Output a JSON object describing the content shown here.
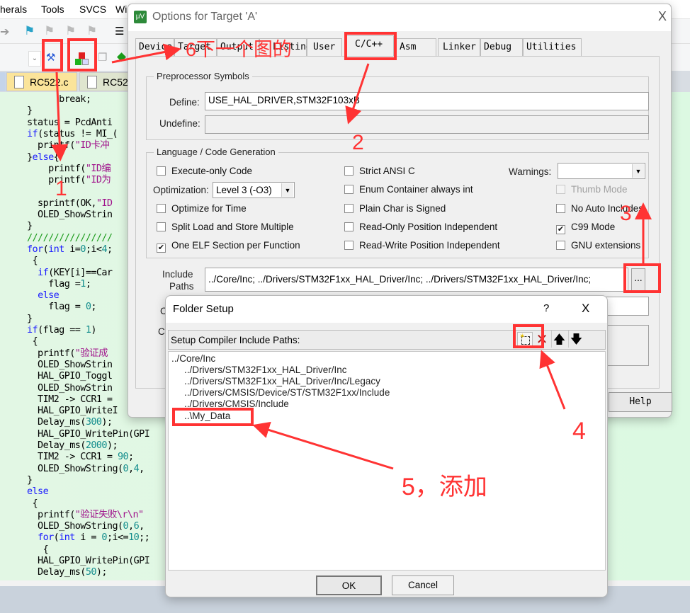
{
  "menubar": {
    "items": [
      "herals",
      "Tools",
      "SVCS",
      "Wi"
    ]
  },
  "file_tabs": [
    {
      "label": "RC522.c",
      "active": true
    },
    {
      "label": "RC52",
      "active": false
    }
  ],
  "editor": {
    "lines": [
      [
        [
          "      ",
          ""
        ],
        [
          "break",
          ""
        ],
        [
          ";",
          ""
        ]
      ],
      [
        [
          "}",
          ""
        ]
      ],
      [
        [
          "status = PcdAnti",
          ""
        ]
      ],
      [
        [
          "if",
          "kw"
        ],
        [
          "(status != MI_(",
          ""
        ]
      ],
      [
        [
          "  printf(",
          ""
        ],
        [
          "\"ID卡冲",
          "st"
        ]
      ],
      [
        [
          "}",
          "",
          ""
        ],
        [
          "else",
          "kw"
        ],
        [
          "{",
          ""
        ]
      ],
      [
        [
          "    printf(",
          ""
        ],
        [
          "\"ID编",
          "st"
        ]
      ],
      [
        [
          "    printf(",
          ""
        ],
        [
          "\"ID为",
          "st"
        ]
      ],
      [
        [
          "",
          ""
        ]
      ],
      [
        [
          "  sprintf(OK,",
          ""
        ],
        [
          "\"ID",
          "st"
        ]
      ],
      [
        [
          "  OLED_ShowStrin",
          ""
        ]
      ],
      [
        [
          "}",
          ""
        ]
      ],
      [
        [
          "////////////////",
          "cm"
        ]
      ],
      [
        [
          "for",
          "kw"
        ],
        [
          "(",
          ""
        ],
        [
          "int",
          "kw"
        ],
        [
          " i=",
          ""
        ],
        [
          "0",
          "nm"
        ],
        [
          ";i<",
          ""
        ],
        [
          "4",
          "nm"
        ],
        [
          ";",
          ""
        ]
      ],
      [
        [
          " {",
          ""
        ]
      ],
      [
        [
          "  ",
          ""
        ],
        [
          "if",
          "kw"
        ],
        [
          "(KEY[i]==Car",
          ""
        ]
      ],
      [
        [
          "    flag =",
          ""
        ],
        [
          "1",
          "nm"
        ],
        [
          ";",
          ""
        ]
      ],
      [
        [
          "  ",
          ""
        ],
        [
          "else",
          "kw"
        ]
      ],
      [
        [
          "    flag = ",
          ""
        ],
        [
          "0",
          "nm"
        ],
        [
          ";",
          ""
        ]
      ],
      [
        [
          "}",
          ""
        ]
      ],
      [
        [
          "if",
          "kw"
        ],
        [
          "(flag == ",
          ""
        ],
        [
          "1",
          "nm"
        ],
        [
          ")",
          ""
        ]
      ],
      [
        [
          " {",
          ""
        ]
      ],
      [
        [
          "  printf(",
          ""
        ],
        [
          "\"验证成",
          "st"
        ]
      ],
      [
        [
          "  OLED_ShowStrin",
          ""
        ]
      ],
      [
        [
          "  HAL_GPIO_Toggl",
          ""
        ]
      ],
      [
        [
          "  OLED_ShowStrin",
          ""
        ]
      ],
      [
        [
          "  TIM2 -> CCR1 =",
          ""
        ]
      ],
      [
        [
          "  HAL_GPIO_WriteI",
          ""
        ]
      ],
      [
        [
          "  Delay_ms(",
          ""
        ],
        [
          "300",
          "nm"
        ],
        [
          ");",
          ""
        ]
      ],
      [
        [
          "  HAL_GPIO_WritePin(GPI",
          ""
        ]
      ],
      [
        [
          "  Delay_ms(",
          ""
        ],
        [
          "2000",
          "nm"
        ],
        [
          ");",
          ""
        ]
      ],
      [
        [
          "  TIM2 -> CCR1 = ",
          ""
        ],
        [
          "90",
          "nm"
        ],
        [
          ";",
          ""
        ]
      ],
      [
        [
          "  OLED_ShowString(",
          ""
        ],
        [
          "0",
          "nm"
        ],
        [
          ",",
          ""
        ],
        [
          "4",
          "nm"
        ],
        [
          ",",
          ""
        ]
      ],
      [
        [
          "}",
          ""
        ]
      ],
      [
        [
          "else",
          "kw"
        ]
      ],
      [
        [
          " {",
          ""
        ]
      ],
      [
        [
          "  printf(",
          ""
        ],
        [
          "\"验证失败\\r\\n\"",
          "st"
        ]
      ],
      [
        [
          "  OLED_ShowString(",
          ""
        ],
        [
          "0",
          "nm"
        ],
        [
          ",",
          ""
        ],
        [
          "6",
          "nm"
        ],
        [
          ",",
          ""
        ]
      ],
      [
        [
          "  ",
          ""
        ],
        [
          "for",
          "kw"
        ],
        [
          "(",
          ""
        ],
        [
          "int",
          "kw"
        ],
        [
          " i = ",
          ""
        ],
        [
          "0",
          "nm"
        ],
        [
          ";i<=",
          ""
        ],
        [
          "10",
          "nm"
        ],
        [
          ";;",
          ""
        ]
      ],
      [
        [
          "   {",
          ""
        ]
      ],
      [
        [
          "  HAL_GPIO_WritePin(GPI",
          ""
        ]
      ],
      [
        [
          "  Delay_ms(",
          ""
        ],
        [
          "50",
          "nm"
        ],
        [
          ");",
          ""
        ]
      ]
    ]
  },
  "options_dialog": {
    "title": "Options for Target 'A'",
    "close": "X",
    "tabs": [
      "Device",
      "Target",
      "Output",
      "Listing",
      "User",
      "C/C++",
      "Asm",
      "Linker",
      "Debug",
      "Utilities"
    ],
    "active_tab": "C/C++",
    "preprocessor": {
      "group": "Preprocessor Symbols",
      "define_label": "Define:",
      "define_value": "USE_HAL_DRIVER,STM32F103xB",
      "undefine_label": "Undefine:",
      "undefine_value": ""
    },
    "language": {
      "group": "Language / Code Generation",
      "checkboxes": [
        {
          "label": "Execute-only Code",
          "checked": false,
          "disabled": false
        },
        {
          "label": "Optimize for Time",
          "checked": false,
          "disabled": false
        },
        {
          "label": "Split Load and Store Multiple",
          "checked": false,
          "disabled": false
        },
        {
          "label": "One ELF Section per Function",
          "checked": true,
          "disabled": false
        },
        {
          "label": "Strict ANSI C",
          "checked": false,
          "disabled": false
        },
        {
          "label": "Enum Container always int",
          "checked": false,
          "disabled": false
        },
        {
          "label": "Plain Char is Signed",
          "checked": false,
          "disabled": false
        },
        {
          "label": "Read-Only Position Independent",
          "checked": false,
          "disabled": false
        },
        {
          "label": "Read-Write Position Independent",
          "checked": false,
          "disabled": false
        },
        {
          "label": "Thumb Mode",
          "checked": false,
          "disabled": true
        },
        {
          "label": "No Auto Includes",
          "checked": false,
          "disabled": false
        },
        {
          "label": "C99 Mode",
          "checked": true,
          "disabled": false
        },
        {
          "label": "GNU extensions",
          "checked": false,
          "disabled": false
        }
      ],
      "optimization_label": "Optimization:",
      "optimization_value": "Level 3 (-O3)",
      "warnings_label": "Warnings:",
      "warnings_value": ""
    },
    "include": {
      "label1": "Include",
      "label2": "Paths",
      "value": "../Core/Inc;     ../Drivers/STM32F1xx_HAL_Driver/Inc;     ../Drivers/STM32F1xx_HAL_Driver/Inc;",
      "browse": "..."
    },
    "misc_label": "C",
    "compiler_label": "C",
    "help": "Help"
  },
  "folder_setup": {
    "title": "Folder Setup",
    "help": "?",
    "close": "X",
    "header": "Setup Compiler Include Paths:",
    "paths": [
      "../Core/Inc",
      "../Drivers/STM32F1xx_HAL_Driver/Inc",
      "../Drivers/STM32F1xx_HAL_Driver/Inc/Legacy",
      "../Drivers/CMSIS/Device/ST/STM32F1xx/Include",
      "../Drivers/CMSIS/Include",
      "..\\My_Data"
    ],
    "ok": "OK",
    "cancel": "Cancel",
    "toolbar_icons": [
      "new-folder-icon",
      "delete-icon",
      "move-up-icon",
      "move-down-icon"
    ]
  },
  "annotations": {
    "a1": "1",
    "a2": "2",
    "a3": "3",
    "a4": "4",
    "a5": "5，添加",
    "a6": "6下一个图的",
    "color": "#ff3333"
  }
}
